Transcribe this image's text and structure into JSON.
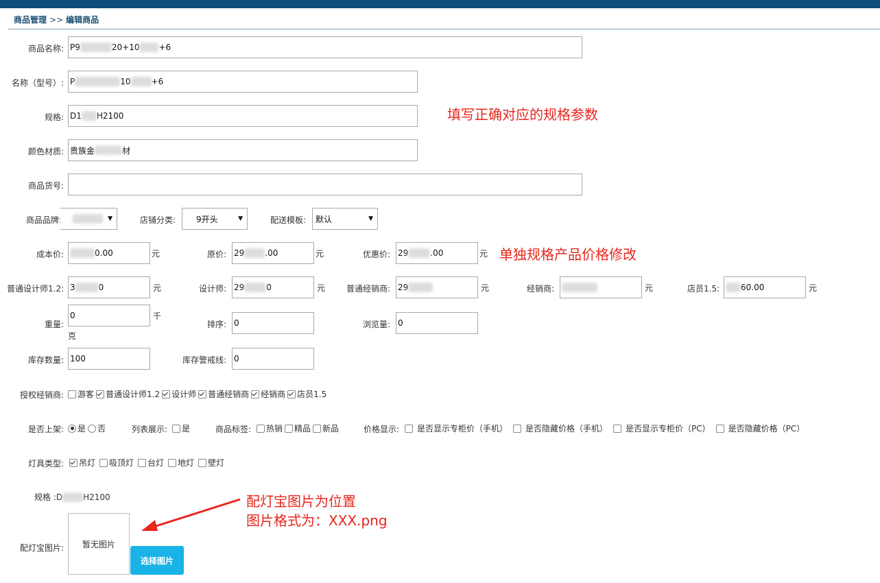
{
  "breadcrumb": {
    "parent": "商品管理",
    "sep": ">>",
    "current": "编辑商品"
  },
  "fields": {
    "name": {
      "label": "商品名称:",
      "value_a": "P9",
      "value_b": "20+10",
      "value_c": "+6"
    },
    "model": {
      "label": "名称（型号）:",
      "value_a": "P",
      "value_b": "10",
      "value_c": "+6"
    },
    "spec": {
      "label": "规格:",
      "value_a": "D1",
      "value_b": "H2100"
    },
    "material": {
      "label": "颜色材质:",
      "value_a": "贵族金",
      "value_b": "材"
    },
    "sku": {
      "label": "商品货号:",
      "value": ""
    }
  },
  "selects": {
    "brand": {
      "label": "商品品牌:"
    },
    "shop_category": {
      "label": "店铺分类:",
      "value": "9开头"
    },
    "delivery": {
      "label": "配送模板:",
      "value": "默认"
    }
  },
  "prices": {
    "cost": {
      "label": "成本价:",
      "value": "0.00",
      "unit": "元"
    },
    "original": {
      "label": "原价:",
      "value_a": "29",
      "value_b": ".00",
      "unit": "元"
    },
    "discount": {
      "label": "优惠价:",
      "value_a": "29",
      "value_b": ".00",
      "unit": "元"
    },
    "designer12": {
      "label": "普通设计师1.2:",
      "value_a": "3",
      "value_b": "0",
      "unit": "元"
    },
    "designer": {
      "label": "设计师:",
      "value_a": "29",
      "value_b": "0",
      "unit": "元"
    },
    "dealer_normal": {
      "label": "普通经销商:",
      "value": "29",
      "unit": "元"
    },
    "dealer": {
      "label": "经销商:",
      "value": "",
      "unit": "元"
    },
    "clerk": {
      "label": "店员1.5:",
      "value": "60.00",
      "unit": "元"
    }
  },
  "misc": {
    "weight": {
      "label": "重量:",
      "value": "0",
      "unit_a": "千",
      "unit_b": "克"
    },
    "sort": {
      "label": "排序:",
      "value": "0"
    },
    "views": {
      "label": "浏览量:",
      "value": "0"
    },
    "stock": {
      "label": "库存数量:",
      "value": "100"
    },
    "stock_alert": {
      "label": "库存警戒线:",
      "value": "0"
    }
  },
  "dealers": {
    "label": "授权经销商:",
    "items": [
      {
        "text": "游客",
        "checked": false
      },
      {
        "text": "普通设计师1.2",
        "checked": true
      },
      {
        "text": "设计师",
        "checked": true
      },
      {
        "text": "普通经销商",
        "checked": true
      },
      {
        "text": "经销商",
        "checked": true
      },
      {
        "text": "店员1.5",
        "checked": true
      }
    ]
  },
  "listing": {
    "label": "是否上架:",
    "yes": "是",
    "no": "否",
    "list_label": "列表展示:",
    "list_yes": "是",
    "tags_label": "商品标签:",
    "tag_hot": "热销",
    "tag_fine": "精品",
    "tag_new": "新品",
    "price_label": "价格显示:",
    "price_opts": [
      "是否显示专柜价（手机）",
      "是否隐藏价格（手机）",
      "是否显示专柜价（PC）",
      "是否隐藏价格（PC）"
    ]
  },
  "lamp": {
    "label": "灯具类型:",
    "items": [
      {
        "text": "吊灯",
        "checked": true
      },
      {
        "text": "吸顶灯",
        "checked": false
      },
      {
        "text": "台灯",
        "checked": false
      },
      {
        "text": "地灯",
        "checked": false
      },
      {
        "text": "壁灯",
        "checked": false
      }
    ]
  },
  "spec_line": {
    "label": "规格 :D",
    "value": "H2100"
  },
  "image": {
    "label": "配灯宝图片:",
    "empty": "暂无图片",
    "button": "选择图片"
  },
  "notes": {
    "spec_note": "填写正确对应的规格参数",
    "price_note": "单独规格产品价格修改",
    "image_note_1": "配灯宝图片为位置",
    "image_note_2": "图片格式为：XXX.png"
  },
  "colors": {
    "accent": "#1ab3e8",
    "note": "#e8261c",
    "topbar": "#0b4d78"
  }
}
